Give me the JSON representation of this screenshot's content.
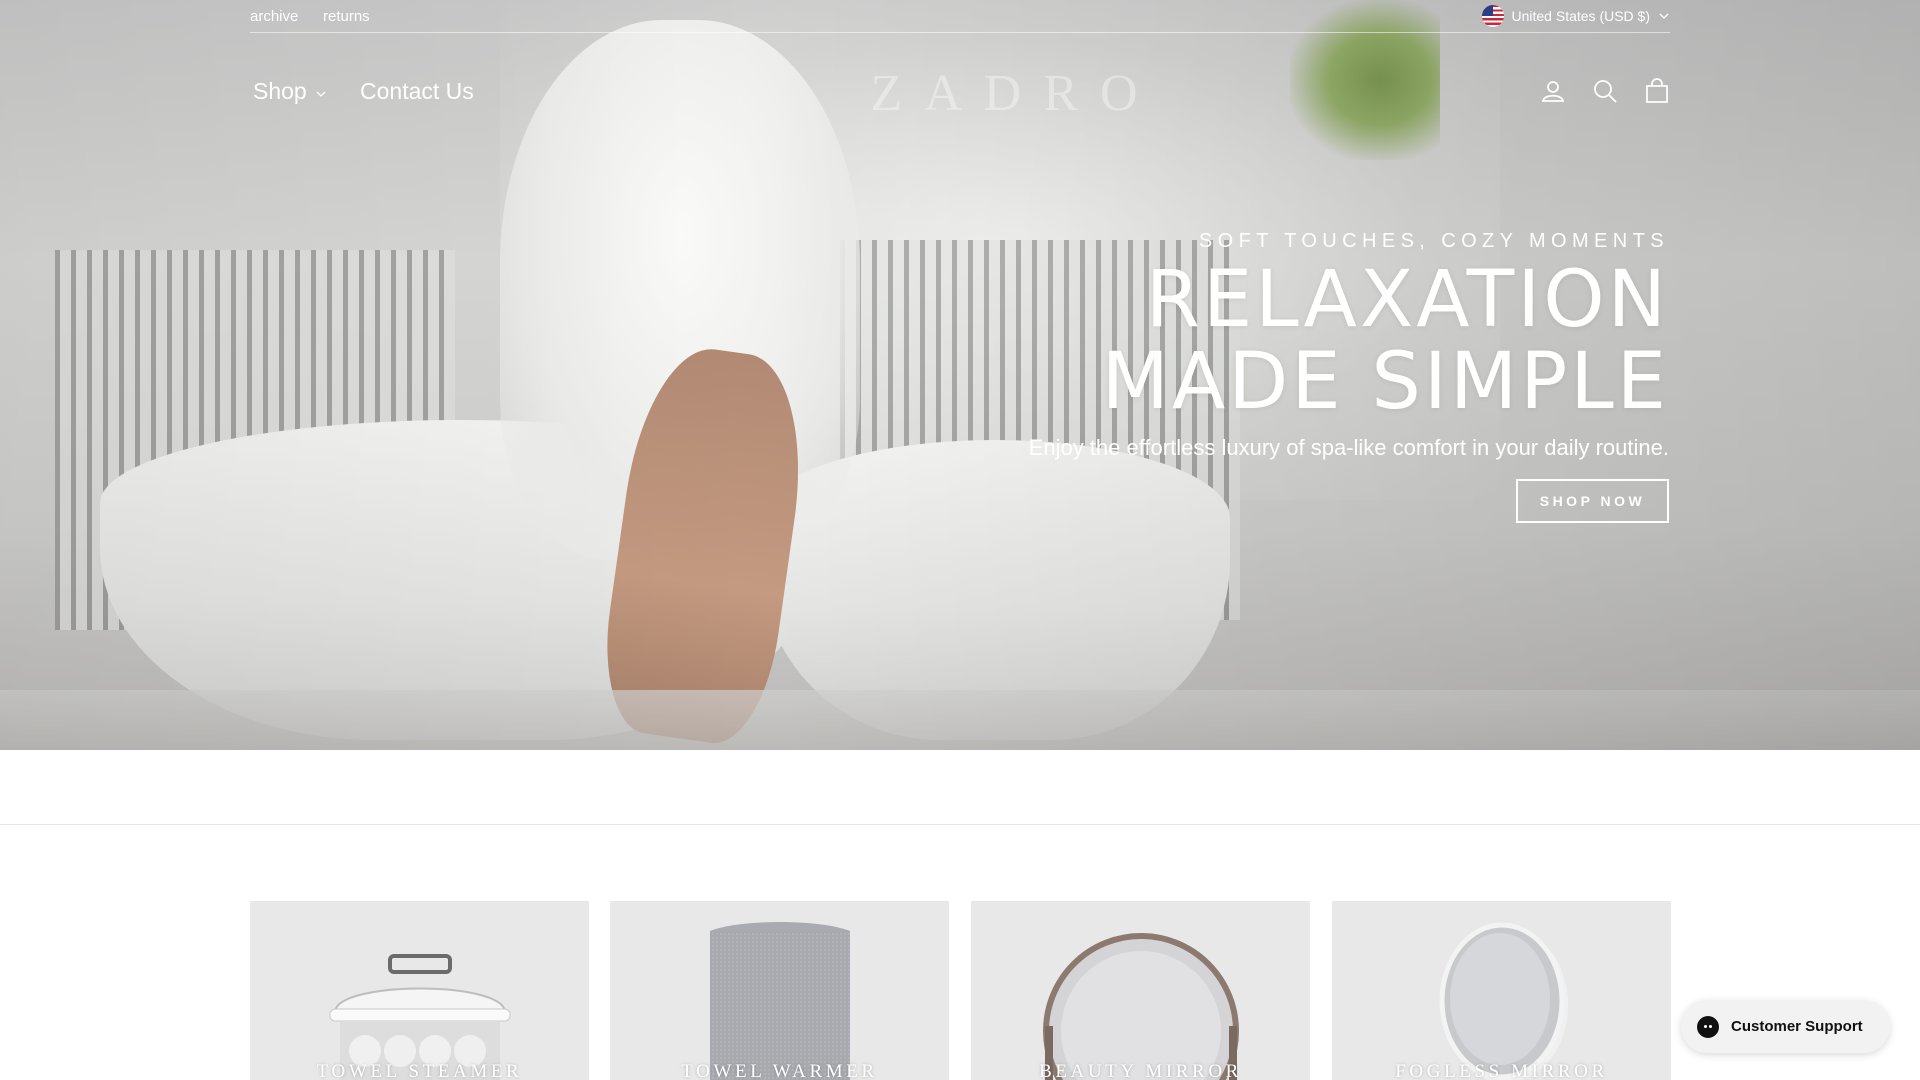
{
  "utility": {
    "links": [
      "archive",
      "returns"
    ],
    "country_selector": "United States (USD $)"
  },
  "header": {
    "nav": {
      "shop": "Shop",
      "contact": "Contact Us"
    },
    "logo": "ZADRO",
    "icons": [
      "account-icon",
      "search-icon",
      "cart-icon"
    ]
  },
  "hero": {
    "eyebrow": "SOFT TOUCHES, COZY MOMENTS",
    "headline_line1": "RELAXATION",
    "headline_line2": "MADE SIMPLE",
    "subline": "Enjoy the effortless luxury of spa-like comfort in your daily routine.",
    "cta": "SHOP NOW"
  },
  "products": [
    {
      "label": "TOWEL STEAMER"
    },
    {
      "label": "TOWEL WARMER"
    },
    {
      "label": "BEAUTY MIRROR"
    },
    {
      "label": "FOGLESS MIRROR"
    }
  ],
  "support": {
    "label": "Customer Support"
  },
  "colors": {
    "text_on_hero": "#ffffff",
    "tile_bg": "#e8e8e8",
    "support_bg": "#f2f2f2"
  }
}
